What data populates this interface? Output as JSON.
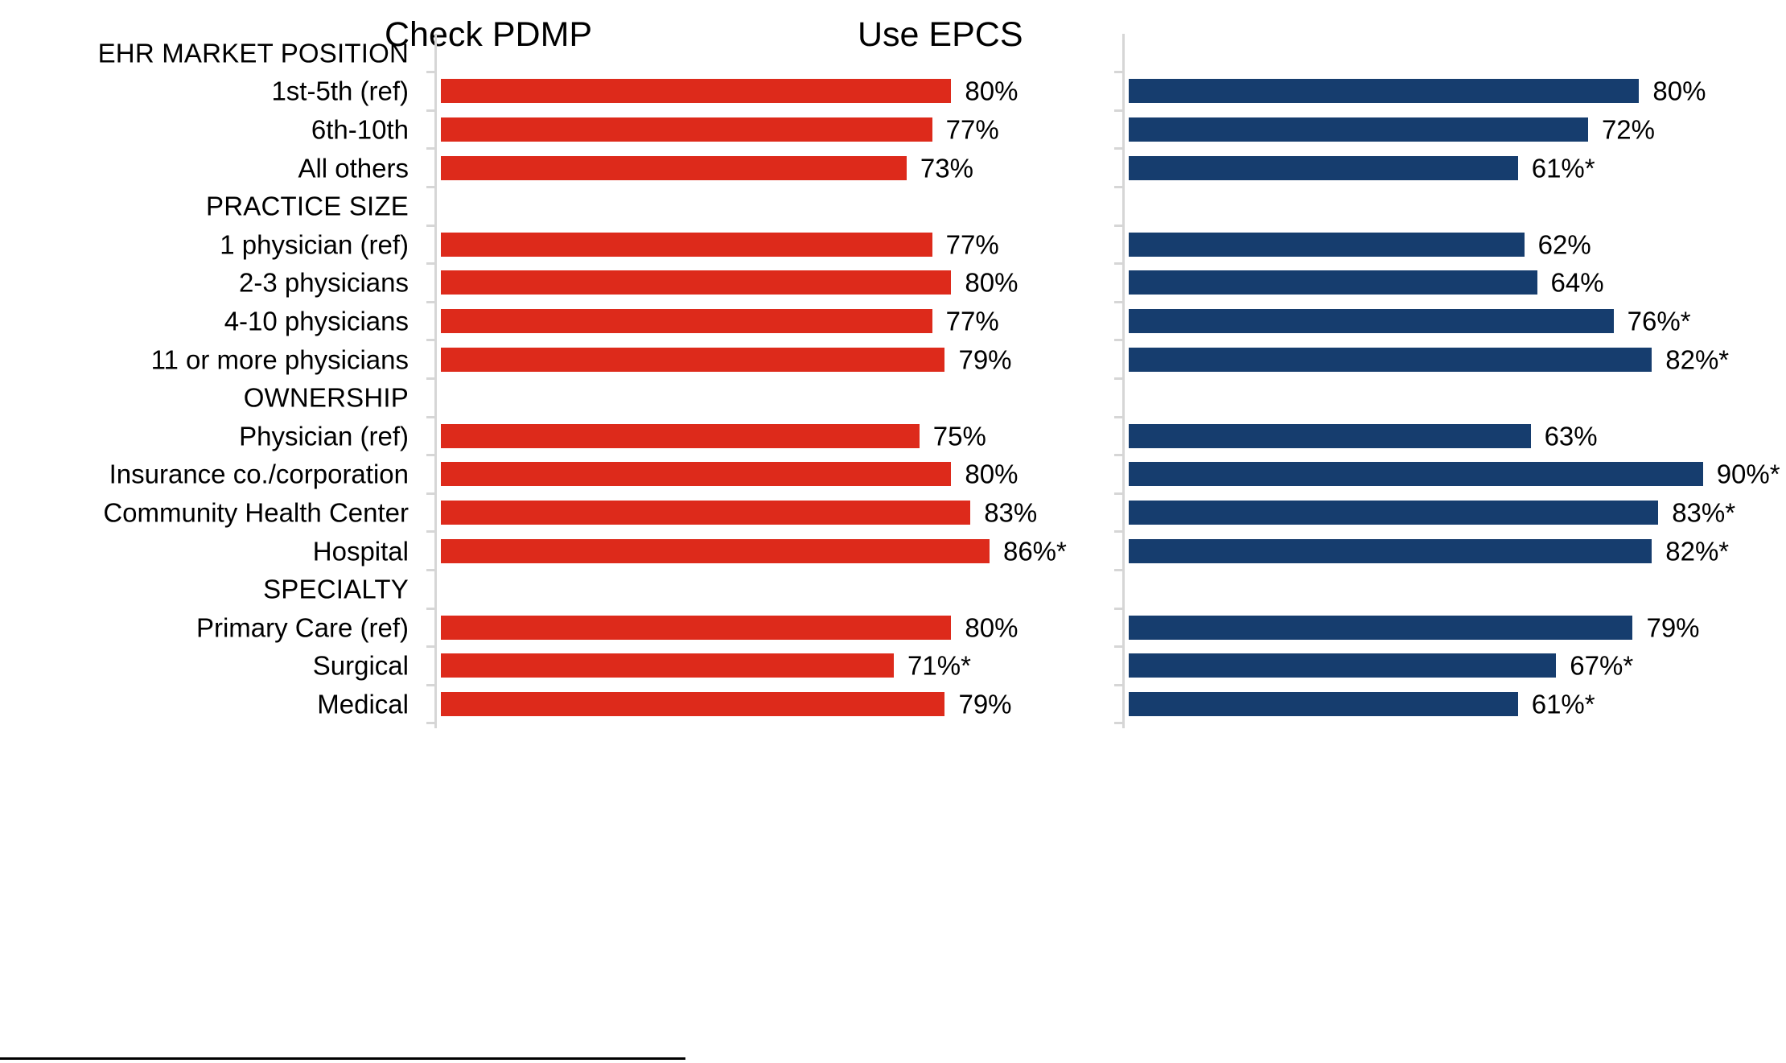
{
  "panels": {
    "left": {
      "title": "Check PDMP",
      "color": "#DD2A1B"
    },
    "right": {
      "title": "Use EPCS",
      "color": "#163D6E"
    }
  },
  "chart_data": {
    "type": "bar",
    "title": "",
    "orientation": "horizontal",
    "xlabel": "",
    "ylabel": "",
    "xlim": [
      0,
      100
    ],
    "grid": false,
    "legend_position": "none",
    "panels": [
      "Check PDMP",
      "Use EPCS"
    ],
    "groups": [
      {
        "header": "EHR MARKET POSITION",
        "rows": [
          {
            "label": "1st-5th (ref)",
            "check_pdmp": 80,
            "check_pdmp_label": "80%",
            "use_epcs": 80,
            "use_epcs_label": "80%"
          },
          {
            "label": "6th-10th",
            "check_pdmp": 77,
            "check_pdmp_label": "77%",
            "use_epcs": 72,
            "use_epcs_label": "72%"
          },
          {
            "label": "All others",
            "check_pdmp": 73,
            "check_pdmp_label": "73%",
            "use_epcs": 61,
            "use_epcs_label": "61%*"
          }
        ]
      },
      {
        "header": "PRACTICE SIZE",
        "rows": [
          {
            "label": "1 physician (ref)",
            "check_pdmp": 77,
            "check_pdmp_label": "77%",
            "use_epcs": 62,
            "use_epcs_label": "62%"
          },
          {
            "label": "2-3 physicians",
            "check_pdmp": 80,
            "check_pdmp_label": "80%",
            "use_epcs": 64,
            "use_epcs_label": "64%"
          },
          {
            "label": "4-10 physicians",
            "check_pdmp": 77,
            "check_pdmp_label": "77%",
            "use_epcs": 76,
            "use_epcs_label": "76%*"
          },
          {
            "label": "11 or more physicians",
            "check_pdmp": 79,
            "check_pdmp_label": "79%",
            "use_epcs": 82,
            "use_epcs_label": "82%*"
          }
        ]
      },
      {
        "header": "OWNERSHIP",
        "rows": [
          {
            "label": "Physician (ref)",
            "check_pdmp": 75,
            "check_pdmp_label": "75%",
            "use_epcs": 63,
            "use_epcs_label": "63%"
          },
          {
            "label": "Insurance co./corporation",
            "check_pdmp": 80,
            "check_pdmp_label": "80%",
            "use_epcs": 90,
            "use_epcs_label": "90%*"
          },
          {
            "label": "Community Health Center",
            "check_pdmp": 83,
            "check_pdmp_label": "83%",
            "use_epcs": 83,
            "use_epcs_label": "83%*"
          },
          {
            "label": "Hospital",
            "check_pdmp": 86,
            "check_pdmp_label": "86%*",
            "use_epcs": 82,
            "use_epcs_label": "82%*"
          }
        ]
      },
      {
        "header": "SPECIALTY",
        "rows": [
          {
            "label": "Primary Care (ref)",
            "check_pdmp": 80,
            "check_pdmp_label": "80%",
            "use_epcs": 79,
            "use_epcs_label": "79%"
          },
          {
            "label": "Surgical",
            "check_pdmp": 71,
            "check_pdmp_label": "71%*",
            "use_epcs": 67,
            "use_epcs_label": "67%*"
          },
          {
            "label": "Medical",
            "check_pdmp": 79,
            "check_pdmp_label": "79%",
            "use_epcs": 61,
            "use_epcs_label": "61%*"
          }
        ]
      }
    ]
  }
}
